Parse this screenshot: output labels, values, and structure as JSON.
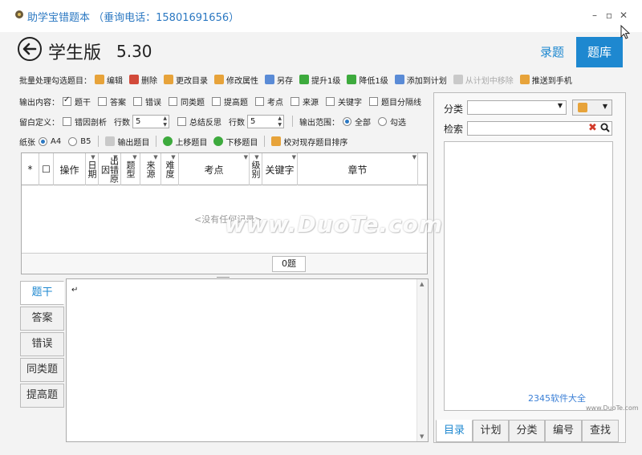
{
  "window": {
    "title": "助学宝错题本 （垂询电话：15801691656）",
    "minimize": "–",
    "maximize": "▫",
    "close": "✕"
  },
  "header": {
    "page_title": "学生版",
    "version": "5.30",
    "tab_record": "录题",
    "tab_bank": "题库"
  },
  "batch_toolbar": {
    "label": "批量处理勾选题目：",
    "items": [
      {
        "label": "编辑",
        "icon": "edit-icon",
        "color": "#e7a33a",
        "enabled": true
      },
      {
        "label": "删除",
        "icon": "delete-icon",
        "color": "#d24a3a",
        "enabled": true
      },
      {
        "label": "更改目录",
        "icon": "folder-icon",
        "color": "#e7a33a",
        "enabled": true
      },
      {
        "label": "修改属性",
        "icon": "properties-icon",
        "color": "#e7a33a",
        "enabled": true
      },
      {
        "label": "另存",
        "icon": "save-as-icon",
        "color": "#5a8bd6",
        "enabled": true
      },
      {
        "label": "提升1级",
        "icon": "raise-level-icon",
        "color": "#3daa3d",
        "enabled": true
      },
      {
        "label": "降低1级",
        "icon": "lower-level-icon",
        "color": "#3daa3d",
        "enabled": true
      },
      {
        "label": "添加到计划",
        "icon": "add-plan-icon",
        "color": "#5a8bd6",
        "enabled": true
      },
      {
        "label": "从计划中移除",
        "icon": "remove-plan-icon",
        "color": "#c9c9c9",
        "enabled": false
      },
      {
        "label": "推送到手机",
        "icon": "push-phone-icon",
        "color": "#e7a33a",
        "enabled": true
      }
    ]
  },
  "output_content": {
    "label": "输出内容：",
    "options": [
      {
        "label": "题干",
        "checked": true
      },
      {
        "label": "答案",
        "checked": false
      },
      {
        "label": "错误",
        "checked": false
      },
      {
        "label": "同类题",
        "checked": false
      },
      {
        "label": "提高题",
        "checked": false
      },
      {
        "label": "考点",
        "checked": false
      },
      {
        "label": "来源",
        "checked": false
      },
      {
        "label": "关键字",
        "checked": false
      },
      {
        "label": "题目分隔线",
        "checked": false
      }
    ]
  },
  "blank_settings": {
    "label": "留白定义：",
    "error_analysis": "错因剖析",
    "rows_label_1": "行数",
    "rows_value_1": "5",
    "summary": "总结反思",
    "rows_label_2": "行数",
    "rows_value_2": "5",
    "range_label": "输出范围：",
    "range_all": "全部",
    "range_checked": "勾选"
  },
  "paper": {
    "label": "纸张",
    "a4": "A4",
    "b5": "B5",
    "export": "输出题目",
    "move_up": "上移题目",
    "move_down": "下移题目",
    "sort": "校对现存题目排序"
  },
  "grid": {
    "columns": [
      {
        "label": "*",
        "vertical": false,
        "filter": false
      },
      {
        "label": "☐",
        "vertical": false,
        "filter": false
      },
      {
        "label": "操作",
        "vertical": false,
        "filter": false
      },
      {
        "label": "日期",
        "vertical": true,
        "filter": true
      },
      {
        "label": "出错原因",
        "vertical": true,
        "filter": true
      },
      {
        "label": "题型",
        "vertical": true,
        "filter": true
      },
      {
        "label": "来源",
        "vertical": true,
        "filter": true
      },
      {
        "label": "难度",
        "vertical": true,
        "filter": true
      },
      {
        "label": "考点",
        "vertical": false,
        "filter": true
      },
      {
        "label": "级别",
        "vertical": true,
        "filter": true
      },
      {
        "label": "关键字",
        "vertical": false,
        "filter": true
      },
      {
        "label": "章节",
        "vertical": false,
        "filter": true
      }
    ],
    "empty_message": "<没有任何记录>",
    "count": "0题"
  },
  "side_tabs": [
    "题干",
    "答案",
    "错误",
    "同类题",
    "提高题"
  ],
  "editor": {
    "caret": "↵"
  },
  "right_panel": {
    "category_label": "分类",
    "search_label": "检索",
    "bottom_tabs": [
      "目录",
      "计划",
      "分类",
      "编号",
      "查找"
    ]
  },
  "watermark": {
    "duote": "www.DuoTe.com",
    "logo": "2345软件大全",
    "logo_url": "www.DuoTe.com"
  },
  "colors": {
    "accent": "#1e88d0",
    "title": "#2b78c2"
  }
}
